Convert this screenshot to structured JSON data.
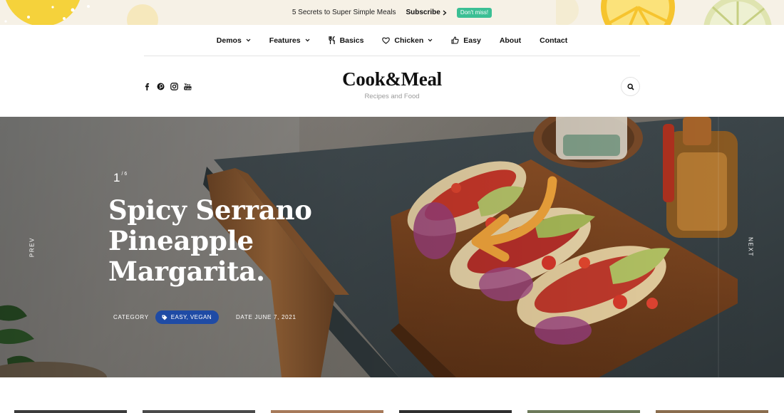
{
  "topbar": {
    "message": "5 Secrets to Super Simple Meals",
    "subscribe_label": "Subscribe",
    "badge_label": "Don't miss!",
    "badge_color": "#3bbf94"
  },
  "nav": {
    "items": [
      {
        "label": "Demos",
        "icon": "chevron-down-icon"
      },
      {
        "label": "Features",
        "icon": "chevron-down-icon"
      },
      {
        "label": "Basics",
        "icon": "fork-knife-icon"
      },
      {
        "label": "Chicken",
        "icon": "heart-icon"
      },
      {
        "label": "Easy",
        "icon": "thumbs-up-icon"
      },
      {
        "label": "About"
      },
      {
        "label": "Contact"
      }
    ]
  },
  "social": [
    "facebook-icon",
    "pinterest-icon",
    "instagram-icon",
    "youtube-icon"
  ],
  "brand": {
    "title": "Cook&Meal",
    "subtitle": "Recipes and Food"
  },
  "hero": {
    "current": "1",
    "total": "/ 6",
    "title": "Spicy Serrano Pineapple Margarita.",
    "category_label": "CATEGORY",
    "category_value": "EASY, VEGAN",
    "category_color": "#1f4ba5",
    "date": "DATE JUNE 7, 2021",
    "prev_label": "PREV",
    "next_label": "NEXT"
  }
}
